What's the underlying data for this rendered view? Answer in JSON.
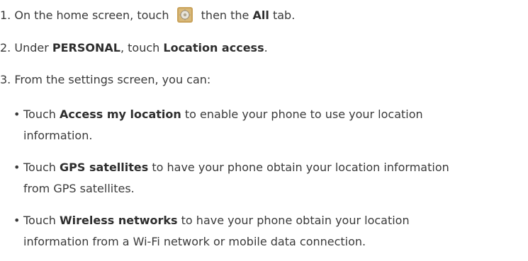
{
  "step1": {
    "num": "1.",
    "text_a": "On the home screen, touch",
    "icon": "settings-app-icon",
    "text_b": "then the",
    "bold": "All",
    "text_c": "tab."
  },
  "step2": {
    "num": "2.",
    "text_a": "Under",
    "bold_a": "PERSONAL",
    "text_b": ", touch",
    "bold_b": "Location access",
    "text_c": "."
  },
  "step3": {
    "num": "3.",
    "text": "From the settings screen, you can:"
  },
  "bullets": [
    {
      "bullet": "•",
      "prefix": "Touch",
      "bold": "Access my location",
      "rest_line1": "to enable your phone to use your location",
      "line2": "information."
    },
    {
      "bullet": "•",
      "prefix": "Touch",
      "bold": "GPS satellites",
      "rest_line1": "to have your phone obtain your location information",
      "line2": "from GPS satellites."
    },
    {
      "bullet": "•",
      "prefix": "Touch",
      "bold": "Wireless networks",
      "rest_line1": "to have your phone obtain your location",
      "line2": "information from a Wi-Fi network or mobile data connection."
    }
  ],
  "colors": {
    "text": "#3a3a3a",
    "icon_bg": "#c9a25a"
  }
}
